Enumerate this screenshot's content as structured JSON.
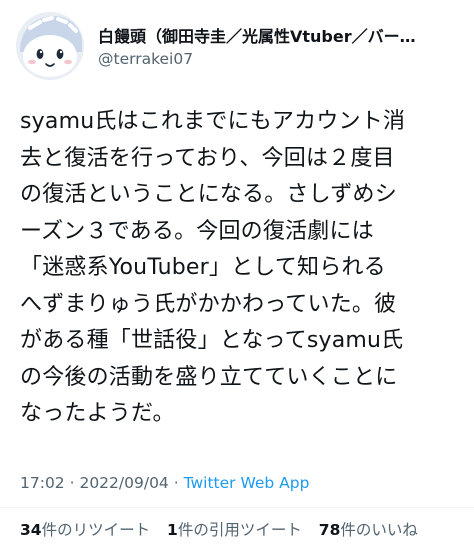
{
  "author": {
    "display_name": "白饅頭（御田寺圭／光属性Vtuber／バー…",
    "handle": "@terrakei07"
  },
  "tweet": {
    "lines": [
      "syamu氏はこれまでにもアカウント消",
      "去と復活を行っており、今回は２度目",
      "の復活ということになる。さしずめシ",
      "ーズン３である。今回の復活劇には",
      "「迷惑系YouTuber」として知られる",
      "へずまりゅう氏がかかわっていた。彼",
      "がある種「世話役」となってsyamu氏",
      "の今後の活動を盛り立てていくことに",
      "なったようだ。"
    ]
  },
  "meta": {
    "time": "17:02",
    "separator1": " · ",
    "date": "2022/09/04",
    "separator2": " · ",
    "app": "Twitter Web App"
  },
  "stats": {
    "retweets_count": "34",
    "retweets_label": "件のリツイート",
    "quotes_count": "1",
    "quotes_label": "件の引用ツイート",
    "likes_count": "78",
    "likes_label": "件のいいね"
  },
  "colors": {
    "text": "#0f1419",
    "secondary": "#536471",
    "link": "#1d9bf0"
  }
}
